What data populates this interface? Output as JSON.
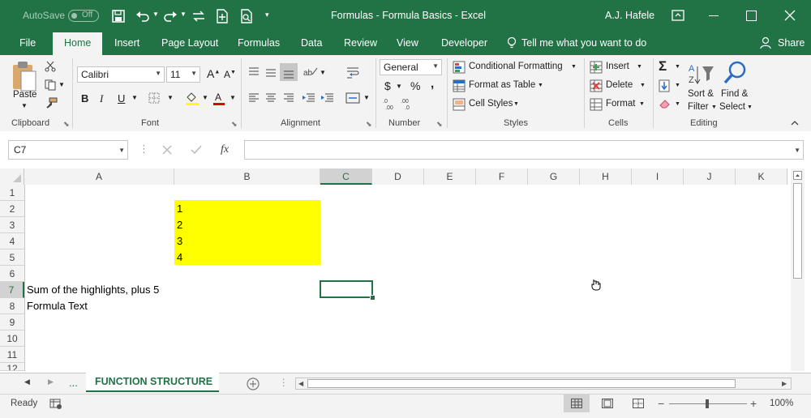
{
  "titlebar": {
    "autosave_label": "AutoSave",
    "autosave_state": "Off",
    "title": "Formulas - Formula Basics  -  Excel",
    "user": "A.J. Hafele"
  },
  "tabs": [
    {
      "label": "File"
    },
    {
      "label": "Home"
    },
    {
      "label": "Insert"
    },
    {
      "label": "Page Layout"
    },
    {
      "label": "Formulas"
    },
    {
      "label": "Data"
    },
    {
      "label": "Review"
    },
    {
      "label": "View"
    },
    {
      "label": "Developer"
    }
  ],
  "tell_me": "Tell me what you want to do",
  "share": "Share",
  "ribbon": {
    "clipboard": {
      "label": "Clipboard",
      "paste": "Paste"
    },
    "font": {
      "label": "Font",
      "name": "Calibri",
      "size": "11",
      "bold": "B",
      "italic": "I",
      "underline": "U"
    },
    "alignment": {
      "label": "Alignment"
    },
    "number": {
      "label": "Number",
      "format": "General",
      "currency": "$",
      "percent": "%",
      "comma": ","
    },
    "styles": {
      "label": "Styles",
      "conditional": "Conditional Formatting",
      "format_table": "Format as Table",
      "cell_styles": "Cell Styles"
    },
    "cells": {
      "label": "Cells",
      "insert": "Insert",
      "delete": "Delete",
      "format": "Format"
    },
    "editing": {
      "label": "Editing",
      "sort1": "Sort &",
      "sort2": "Filter",
      "find1": "Find &",
      "find2": "Select"
    }
  },
  "formula_bar": {
    "name_box": "C7",
    "formula": "",
    "fx": "fx"
  },
  "columns": [
    "A",
    "B",
    "C",
    "D",
    "E",
    "F",
    "G",
    "H",
    "I",
    "J",
    "K"
  ],
  "rows": [
    "1",
    "2",
    "3",
    "4",
    "5",
    "6",
    "7",
    "8",
    "9",
    "10",
    "11",
    "12"
  ],
  "cells": {
    "B2": "1",
    "B3": "2",
    "B4": "3",
    "B5": "4",
    "A7": "Sum of the highlights, plus 5",
    "A8": "Formula Text"
  },
  "highlight_color": "#ffff00",
  "accent_color": "#217346",
  "sheet_tab": "FUNCTION STRUCTURE",
  "sheet_more": "...",
  "status": {
    "ready": "Ready",
    "zoom": "100%"
  }
}
